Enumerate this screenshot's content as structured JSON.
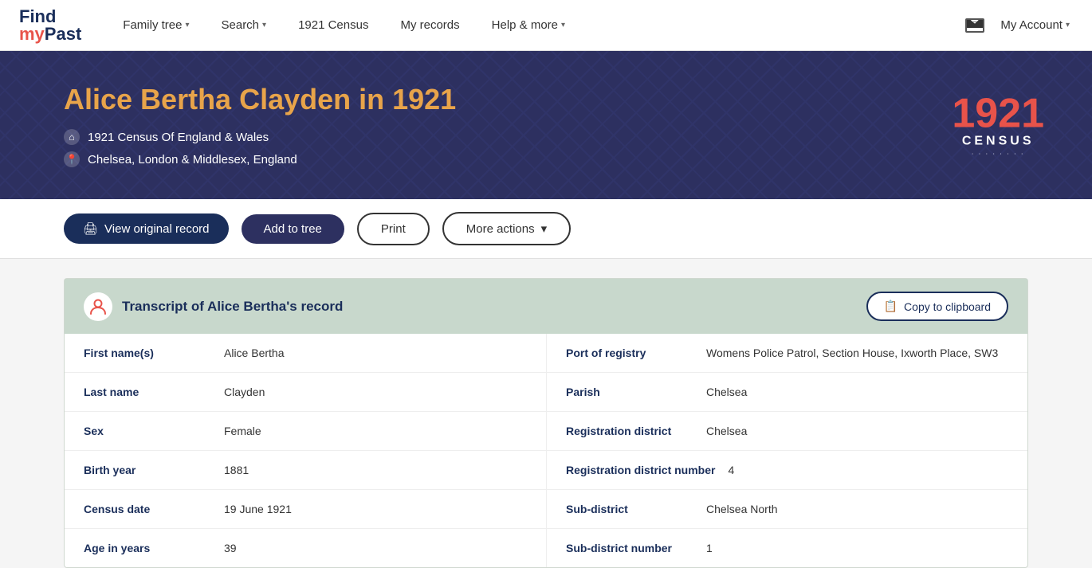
{
  "nav": {
    "logo": {
      "line1": "Find",
      "line2_accent": "my",
      "line2_normal": "Past"
    },
    "items": [
      {
        "label": "Family tree",
        "hasDropdown": true,
        "id": "family-tree"
      },
      {
        "label": "Search",
        "hasDropdown": true,
        "id": "search"
      },
      {
        "label": "1921 Census",
        "hasDropdown": false,
        "id": "census-1921"
      },
      {
        "label": "My records",
        "hasDropdown": false,
        "id": "my-records"
      },
      {
        "label": "Help & more",
        "hasDropdown": true,
        "id": "help-more"
      }
    ],
    "account_label": "My Account",
    "mail_icon": "✉"
  },
  "hero": {
    "title": "Alice Bertha Clayden in 1921",
    "collection": "1921 Census Of England & Wales",
    "location": "Chelsea, London & Middlesex, England",
    "badge_year": "1921",
    "badge_text": "CENSUS"
  },
  "actions": {
    "view_original": "View original record",
    "add_to_tree": "Add to tree",
    "print": "Print",
    "more_actions": "More actions",
    "copy_to_clipboard": "Copy to clipboard"
  },
  "transcript": {
    "title": "Transcript of Alice Bertha's record",
    "left_fields": [
      {
        "label": "First name(s)",
        "value": "Alice Bertha"
      },
      {
        "label": "Last name",
        "value": "Clayden"
      },
      {
        "label": "Sex",
        "value": "Female"
      },
      {
        "label": "Birth year",
        "value": "1881"
      },
      {
        "label": "Census date",
        "value": "19 June 1921"
      },
      {
        "label": "Age in years",
        "value": "39"
      }
    ],
    "right_fields": [
      {
        "label": "Port of registry",
        "value": "Womens Police Patrol, Section House, Ixworth Place, SW3"
      },
      {
        "label": "Parish",
        "value": "Chelsea"
      },
      {
        "label": "Registration district",
        "value": "Chelsea"
      },
      {
        "label": "Registration district number",
        "value": "4"
      },
      {
        "label": "Sub-district",
        "value": "Chelsea North"
      },
      {
        "label": "Sub-district number",
        "value": "1"
      }
    ]
  }
}
